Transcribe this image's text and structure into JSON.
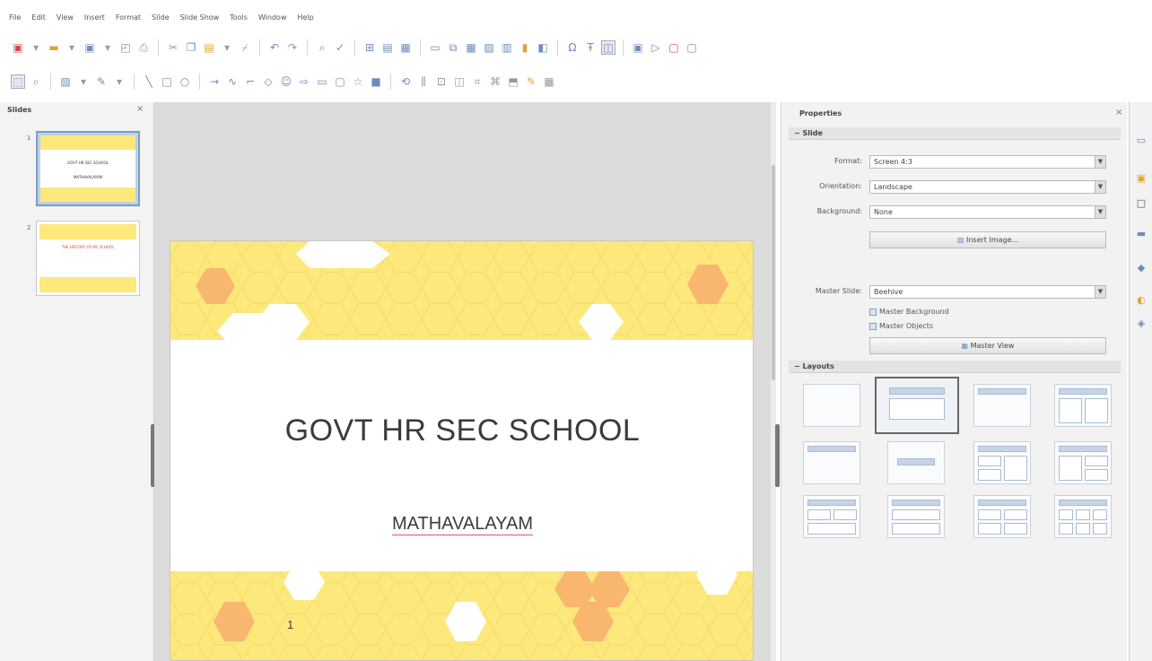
{
  "menubar": [
    "File",
    "Edit",
    "View",
    "Insert",
    "Format",
    "Slide",
    "Slide Show",
    "Tools",
    "Window",
    "Help"
  ],
  "slides_panel": {
    "title": "Slides",
    "close_icon": "close-icon",
    "thumbnails": [
      {
        "number": "1",
        "line1": "GOVT HR SEC SCHOOL",
        "line2": "MATHAVALAYAM"
      },
      {
        "number": "2",
        "line1": "THE HISTORY OF MY SCHOOL",
        "line2": ""
      }
    ]
  },
  "slide": {
    "title": "GOVT HR SEC SCHOOL",
    "subtitle": "MATHAVALAYAM",
    "page_number": "1",
    "colors": {
      "band": "#fde87c",
      "hex_light": "#fef3a8",
      "hex_orange": "#f9b66f",
      "hex_white": "#ffffff"
    }
  },
  "properties": {
    "title": "Properties",
    "slide_section": {
      "heading": "Slide",
      "format_label": "Format:",
      "format_value": "Screen 4:3",
      "orientation_label": "Orientation:",
      "orientation_value": "Landscape",
      "background_label": "Background:",
      "background_value": "None",
      "insert_image_button": "Insert Image...",
      "master_slide_label": "Master Slide:",
      "master_slide_value": "Beehive",
      "master_background_check": "Master Background",
      "master_objects_check": "Master Objects",
      "master_view_button": "Master View"
    },
    "layouts_heading": "Layouts"
  }
}
